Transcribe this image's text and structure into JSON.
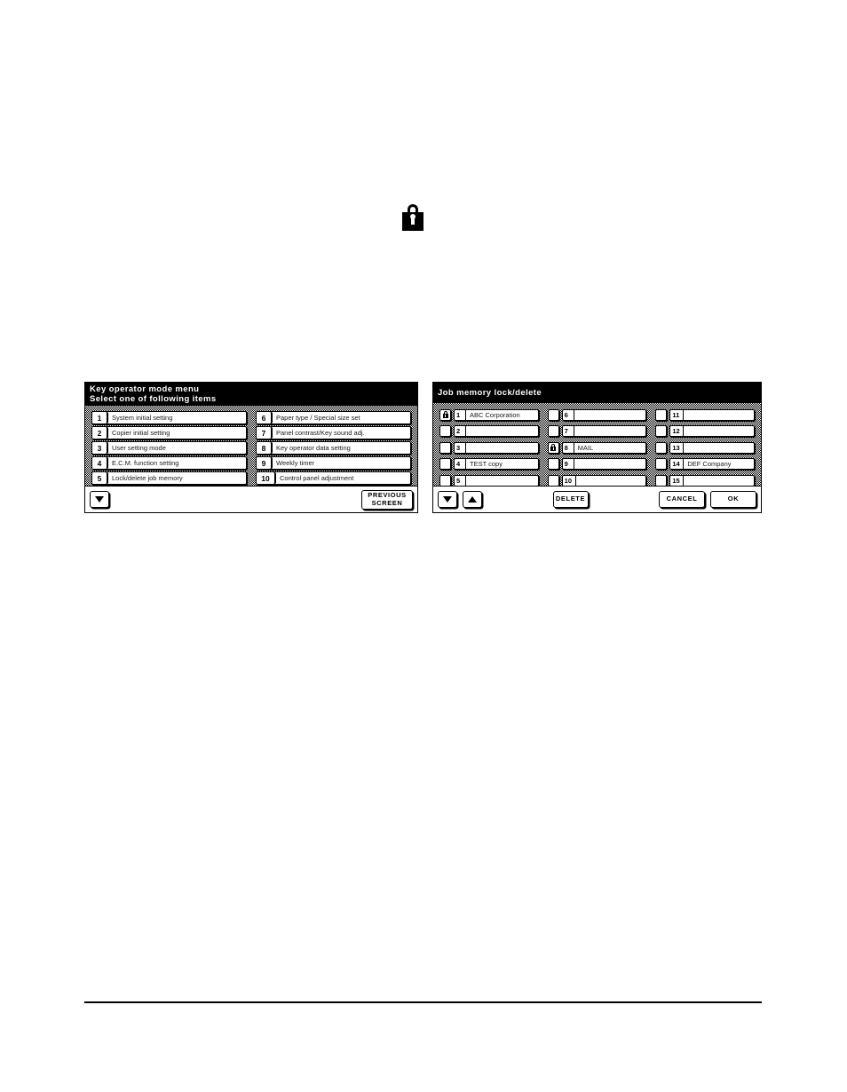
{
  "page": {
    "lock_icon": "padlock-icon",
    "footer_rule": true
  },
  "keyop_panel": {
    "title_line1": "Key operator mode menu",
    "title_line2": "Select one of following items",
    "items_left": [
      {
        "number": "1",
        "label": "System initial setting"
      },
      {
        "number": "2",
        "label": "Copier initial setting"
      },
      {
        "number": "3",
        "label": "User setting mode"
      },
      {
        "number": "4",
        "label": "E.C.M. function setting"
      },
      {
        "number": "5",
        "label": "Lock/delete job memory"
      }
    ],
    "items_right": [
      {
        "number": "6",
        "label": "Paper type / Special size set"
      },
      {
        "number": "7",
        "label": "Panel contrast/Key sound adj."
      },
      {
        "number": "8",
        "label": "Key operator data setting"
      },
      {
        "number": "9",
        "label": "Weekly timer"
      },
      {
        "number": "10",
        "label": "Control panel adjustment"
      }
    ],
    "scroll_down_icon": "arrow-down-icon",
    "previous_screen_line1": "PREVIOUS",
    "previous_screen_line2": "SCREEN"
  },
  "jobmem_panel": {
    "title": "Job memory lock/delete",
    "columns": [
      [
        {
          "number": "1",
          "name": "ABC Corporation",
          "locked": true
        },
        {
          "number": "2",
          "name": "",
          "locked": false
        },
        {
          "number": "3",
          "name": "",
          "locked": false
        },
        {
          "number": "4",
          "name": "TEST copy",
          "locked": false
        },
        {
          "number": "5",
          "name": "",
          "locked": false
        }
      ],
      [
        {
          "number": "6",
          "name": "",
          "locked": false
        },
        {
          "number": "7",
          "name": "",
          "locked": false
        },
        {
          "number": "8",
          "name": "MAIL",
          "locked": true
        },
        {
          "number": "9",
          "name": "",
          "locked": false
        },
        {
          "number": "10",
          "name": "",
          "locked": false
        }
      ],
      [
        {
          "number": "11",
          "name": "",
          "locked": false
        },
        {
          "number": "12",
          "name": "",
          "locked": false
        },
        {
          "number": "13",
          "name": "",
          "locked": false
        },
        {
          "number": "14",
          "name": "DEF Company",
          "locked": false
        },
        {
          "number": "15",
          "name": "",
          "locked": false
        }
      ]
    ],
    "scroll_down_icon": "arrow-down-icon",
    "scroll_up_icon": "arrow-up-icon",
    "delete_label": "DELETE",
    "cancel_label": "CANCEL",
    "ok_label": "OK"
  },
  "colors": {
    "titlebar_bg": "#000000",
    "titlebar_fg": "#ffffff",
    "panel_bg": "#ffffff",
    "outline": "#000000"
  }
}
